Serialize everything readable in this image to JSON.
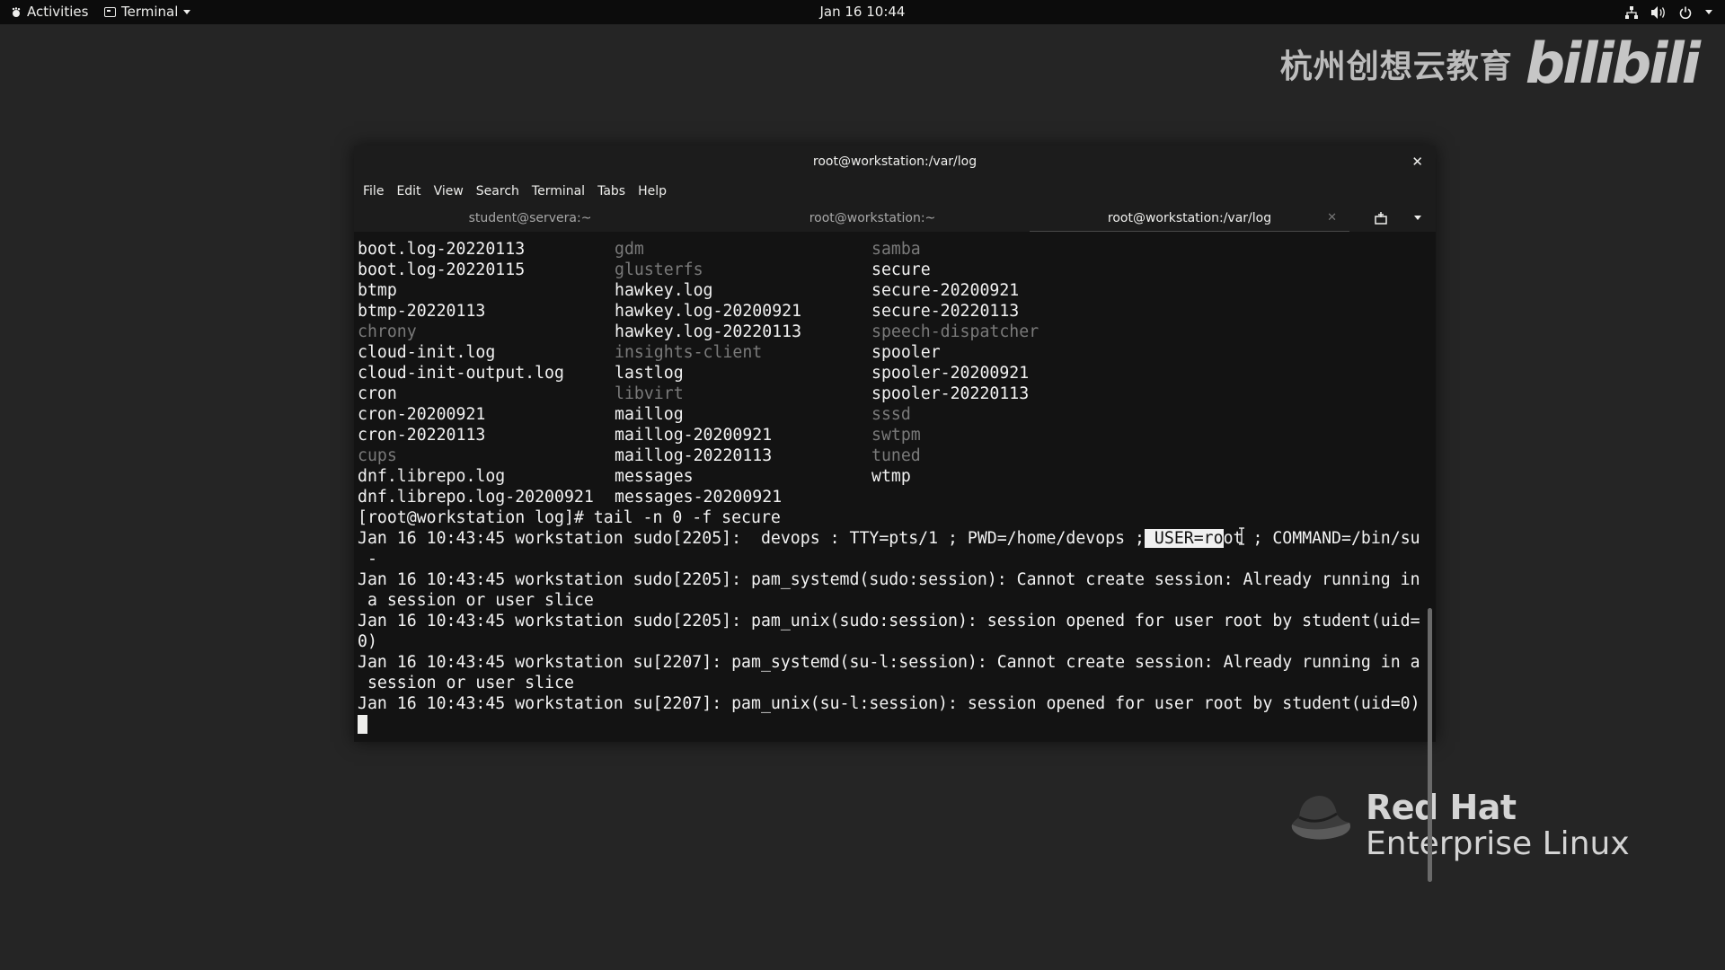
{
  "topbar": {
    "activities": "Activities",
    "app_name": "Terminal",
    "clock": "Jan 16  10:44",
    "icons": [
      "network-icon",
      "volume-icon",
      "power-icon"
    ]
  },
  "watermark": {
    "text": "杭州创想云教育",
    "logo": "bilibili"
  },
  "redhat": {
    "line1": "Red Hat",
    "line2": "Enterprise Linux"
  },
  "window": {
    "title": "root@workstation:/var/log",
    "menu": [
      "File",
      "Edit",
      "View",
      "Search",
      "Terminal",
      "Tabs",
      "Help"
    ],
    "tabs": [
      {
        "label": "student@servera:~"
      },
      {
        "label": "root@workstation:~"
      },
      {
        "label": "root@workstation:/var/log"
      }
    ]
  },
  "terminal": {
    "ls_rows": [
      [
        {
          "t": "boot.log-20220113",
          "dim": false
        },
        {
          "t": "gdm",
          "dim": true
        },
        {
          "t": "samba",
          "dim": true
        }
      ],
      [
        {
          "t": "boot.log-20220115",
          "dim": false
        },
        {
          "t": "glusterfs",
          "dim": true
        },
        {
          "t": "secure",
          "dim": false
        }
      ],
      [
        {
          "t": "btmp",
          "dim": false
        },
        {
          "t": "hawkey.log",
          "dim": false
        },
        {
          "t": "secure-20200921",
          "dim": false
        }
      ],
      [
        {
          "t": "btmp-20220113",
          "dim": false
        },
        {
          "t": "hawkey.log-20200921",
          "dim": false
        },
        {
          "t": "secure-20220113",
          "dim": false
        }
      ],
      [
        {
          "t": "chrony",
          "dim": true
        },
        {
          "t": "hawkey.log-20220113",
          "dim": false
        },
        {
          "t": "speech-dispatcher",
          "dim": true
        }
      ],
      [
        {
          "t": "cloud-init.log",
          "dim": false
        },
        {
          "t": "insights-client",
          "dim": true
        },
        {
          "t": "spooler",
          "dim": false
        }
      ],
      [
        {
          "t": "cloud-init-output.log",
          "dim": false
        },
        {
          "t": "lastlog",
          "dim": false
        },
        {
          "t": "spooler-20200921",
          "dim": false
        }
      ],
      [
        {
          "t": "cron",
          "dim": false
        },
        {
          "t": "libvirt",
          "dim": true
        },
        {
          "t": "spooler-20220113",
          "dim": false
        }
      ],
      [
        {
          "t": "cron-20200921",
          "dim": false
        },
        {
          "t": "maillog",
          "dim": false
        },
        {
          "t": "sssd",
          "dim": true
        }
      ],
      [
        {
          "t": "cron-20220113",
          "dim": false
        },
        {
          "t": "maillog-20200921",
          "dim": false
        },
        {
          "t": "swtpm",
          "dim": true
        }
      ],
      [
        {
          "t": "cups",
          "dim": true
        },
        {
          "t": "maillog-20220113",
          "dim": false
        },
        {
          "t": "tuned",
          "dim": true
        }
      ],
      [
        {
          "t": "dnf.librepo.log",
          "dim": false
        },
        {
          "t": "messages",
          "dim": false
        },
        {
          "t": "wtmp",
          "dim": false
        }
      ],
      [
        {
          "t": "dnf.librepo.log-20200921",
          "dim": false
        },
        {
          "t": "messages-20200921",
          "dim": false
        },
        {
          "t": "",
          "dim": false
        }
      ]
    ],
    "prompt_line": "[root@workstation log]# tail -n 0 -f secure",
    "sudo_line_pre": "Jan 16 10:43:45 workstation sudo[2205]:  devops : TTY=pts/1 ; PWD=/home/devops ;",
    "sudo_line_hl": " USER=ro",
    "sudo_line_post": "ot ; COMMAND=/bin/su",
    "log_lines": [
      " -",
      "Jan 16 10:43:45 workstation sudo[2205]: pam_systemd(sudo:session): Cannot create session: Already running in",
      " a session or user slice",
      "Jan 16 10:43:45 workstation sudo[2205]: pam_unix(sudo:session): session opened for user root by student(uid=",
      "0)",
      "Jan 16 10:43:45 workstation su[2207]: pam_systemd(su-l:session): Cannot create session: Already running in a",
      " session or user slice",
      "Jan 16 10:43:45 workstation su[2207]: pam_unix(su-l:session): session opened for user root by student(uid=0)"
    ]
  },
  "colors": {
    "desktop": "#252525",
    "topbar": "#0c0c0c",
    "terminal_bg": "#131313",
    "terminal_fg": "#f2f2f2",
    "dim_dir": "#7a7a7a"
  }
}
